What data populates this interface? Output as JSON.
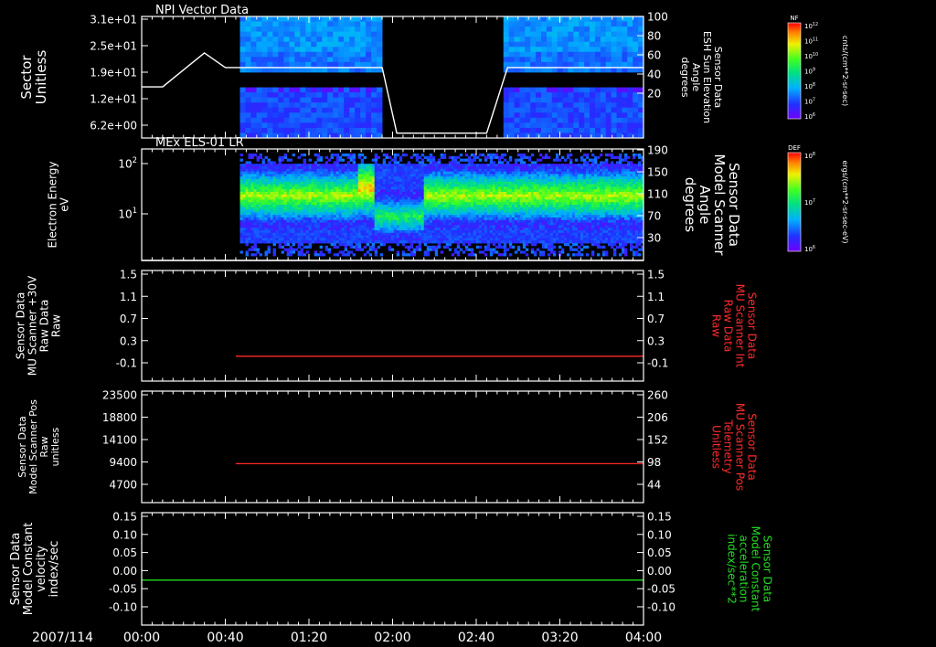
{
  "date_label": "2007/114",
  "x_ticks": [
    "00:00",
    "00:40",
    "01:20",
    "02:00",
    "02:40",
    "03:20",
    "04:00"
  ],
  "colors": {
    "bg": "#000000",
    "axis": "#ffffff",
    "red": "#ff2a2a",
    "green": "#22dd22"
  },
  "chart_data": [
    {
      "type": "heatmap",
      "title": "NPI Vector Data",
      "ylabel": [
        "Sector",
        "Unitless"
      ],
      "y_ticks": [
        "3.1e+01",
        "2.5e+01",
        "1.9e+01",
        "1.2e+01",
        "6.2e+00"
      ],
      "y2label": [
        "Sensor Data",
        "ESH Sun Elevation",
        "Angle",
        "degrees"
      ],
      "y2_ticks": [
        "100",
        "80",
        "60",
        "40",
        "20"
      ],
      "y2lim": [
        0,
        100
      ],
      "data_intervals": [
        [
          "00:47",
          "01:55"
        ],
        [
          "02:53",
          "04:00"
        ]
      ],
      "overlay_line": {
        "name": "ESH Sun Elevation Angle",
        "x": [
          "00:00",
          "00:10",
          "00:30",
          "00:40",
          "01:55",
          "02:02",
          "02:45",
          "02:55",
          "04:00"
        ],
        "y": [
          42,
          42,
          70,
          58,
          58,
          4,
          4,
          58,
          58
        ]
      },
      "colorbar": {
        "label": "NF",
        "units": "cnts/(cm**2-sr-sec)",
        "ticks": [
          "10^12",
          "10^11",
          "10^10",
          "10^9",
          "10^8",
          "10^7",
          "10^6"
        ]
      }
    },
    {
      "type": "heatmap",
      "title": "MEx ELS-01 LR",
      "ylabel": [
        "Electron Energy",
        "eV"
      ],
      "y_ticks": [
        "10^2",
        "10^1"
      ],
      "y_scale": "log",
      "y2label": [
        "Sensor Data",
        "Model Scanner",
        "Angle",
        "degrees"
      ],
      "y2_ticks": [
        "190",
        "150",
        "110",
        "70",
        "30"
      ],
      "y2lim": [
        10,
        190
      ],
      "data_interval": [
        "00:47",
        "04:00"
      ],
      "overlay_line": {
        "name": "Model Scanner Angle",
        "x": [
          "00:00",
          "04:00"
        ],
        "y": [
          10,
          10
        ]
      },
      "colorbar": {
        "label": "DEF",
        "units": "ergs/(cm**2-sr-sec-eV)",
        "ticks": [
          "10^8",
          "10^7",
          "10^6"
        ]
      }
    },
    {
      "type": "line",
      "ylabel": [
        "Sensor Data",
        "MU Scanner +30V",
        "Raw Data",
        "Raw"
      ],
      "y_ticks": [
        "1.5",
        "1.1",
        "0.7",
        "0.3",
        "-0.1"
      ],
      "ylim": [
        -0.5,
        1.5
      ],
      "y2label": [
        "Sensor Data",
        "MU Scanner Int",
        "Raw Data",
        "Raw"
      ],
      "y2_ticks": [
        "1.5",
        "1.1",
        "0.7",
        "0.3",
        "-0.1"
      ],
      "series": [
        {
          "x": [
            "00:45",
            "04:00"
          ],
          "y": [
            -0.05,
            -0.05
          ],
          "color": "#ff2a2a"
        }
      ]
    },
    {
      "type": "line",
      "ylabel": [
        "Sensor Data",
        "Model Scanner Pos",
        "Raw",
        "unitless"
      ],
      "y_ticks": [
        "23500",
        "18800",
        "14100",
        "9400",
        "4700"
      ],
      "ylim": [
        0,
        23500
      ],
      "y2label": [
        "Sensor Data",
        "MU Scanner Pos",
        "Telemetry",
        "Unitless"
      ],
      "y2_ticks": [
        "260",
        "206",
        "152",
        "98",
        "44"
      ],
      "series": [
        {
          "x": [
            "00:45",
            "04:00"
          ],
          "y": [
            8200,
            8200
          ],
          "color": "#ff2a2a"
        }
      ]
    },
    {
      "type": "line",
      "ylabel": [
        "Sensor Data",
        "Model Constant",
        "velocity",
        "index/sec"
      ],
      "y_ticks": [
        "0.15",
        "0.10",
        "0.05",
        "0.00",
        "-0.05",
        "-0.10"
      ],
      "ylim": [
        -0.1,
        0.15
      ],
      "y2label": [
        "Sensor Data",
        "Model Constant",
        "acceleration",
        "index/sec**2"
      ],
      "y2_ticks": [
        "0.15",
        "0.10",
        "0.05",
        "0.00",
        "-0.05",
        "-0.10"
      ],
      "series": [
        {
          "x": [
            "00:00",
            "04:00"
          ],
          "y": [
            0,
            0
          ],
          "color": "#22dd22"
        }
      ]
    }
  ]
}
